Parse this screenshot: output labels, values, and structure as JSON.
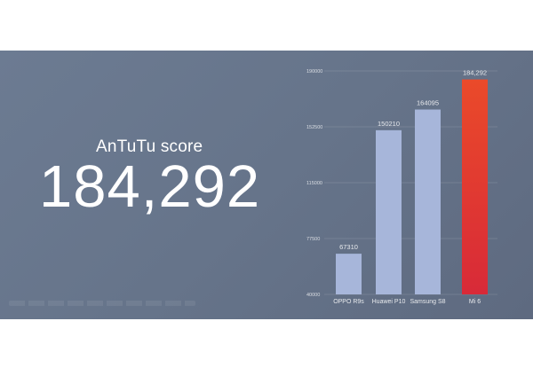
{
  "headline": {
    "label": "AnTuTu score",
    "score": "184,292"
  },
  "colors": {
    "background": "#66748a",
    "bar": "#a7b6da",
    "highlight_top": "#ea4a2a",
    "highlight_bottom": "#d82a38",
    "text": "#ffffff"
  },
  "chart_data": {
    "type": "bar",
    "categories": [
      "OPPO R9s",
      "Huawei P10",
      "Samsung S8",
      "Mi 6"
    ],
    "values": [
      67310,
      150210,
      164095,
      184292
    ],
    "value_labels": [
      "67310",
      "150210",
      "164095",
      "184,292"
    ],
    "highlight_index": 3,
    "yticks": [
      40000,
      77500,
      115000,
      152500,
      190000
    ],
    "ytick_labels": [
      "40000",
      "77500",
      "115000",
      "152500",
      "190000"
    ],
    "ylim": [
      40000,
      190000
    ],
    "grid": true,
    "title": "",
    "xlabel": "",
    "ylabel": ""
  }
}
